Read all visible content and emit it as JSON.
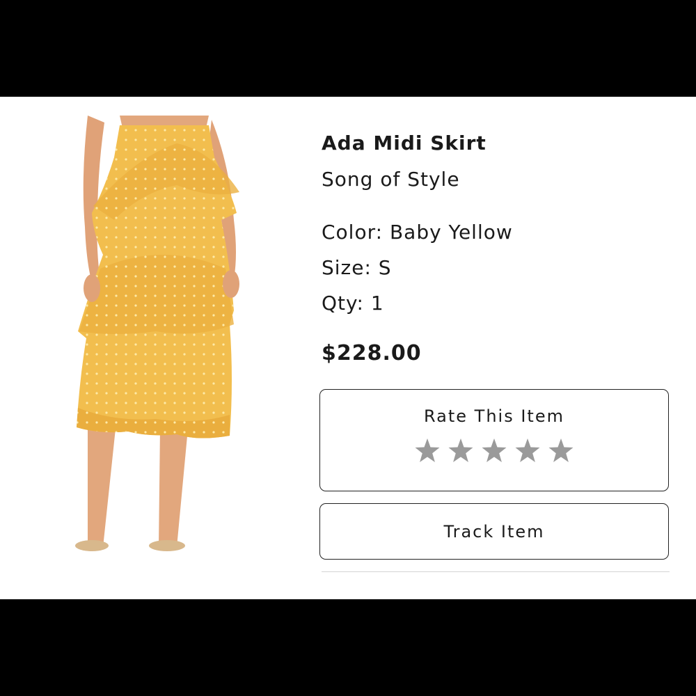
{
  "product": {
    "name": "Ada Midi Skirt",
    "brand": "Song of Style",
    "color": "Color: Baby Yellow",
    "size": "Size: S",
    "qty": "Qty: 1",
    "price": "$228.00"
  },
  "actions": {
    "rate_label": "Rate This Item",
    "rating": 0,
    "max_rating": 5,
    "track_label": "Track Item"
  },
  "colors": {
    "star": "#9a9a9a",
    "skirt": "#f2be4e",
    "letterbox": "#000000"
  }
}
